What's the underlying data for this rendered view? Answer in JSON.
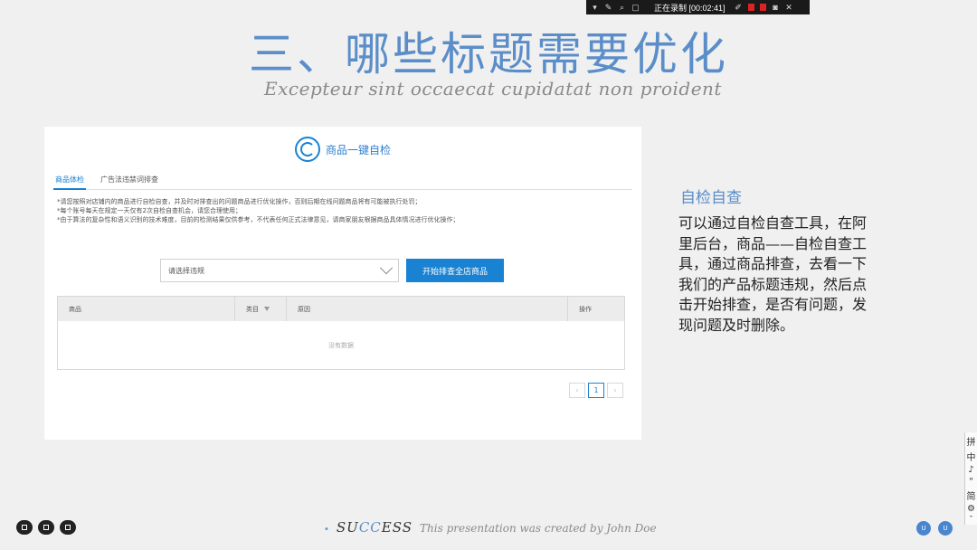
{
  "recorder": {
    "status": "正在录制 [00:02:41]"
  },
  "slide": {
    "title": "三、哪些标题需要优化",
    "subtitle": "Excepteur sint occaecat cupidatat non proident"
  },
  "panel": {
    "title": "商品一键自检",
    "tabs": [
      {
        "label": "商品体检",
        "active": true
      },
      {
        "label": "广告法违禁词排查",
        "active": false
      }
    ],
    "notice_lines": [
      "*请您按照对店铺内的商品进行自检自查，并及时对排查出的问题商品进行优化操作，否则后期在线问题商品将有可能被执行处罚；",
      "*每个账号每天在规定一天仅有2次自检自查机会，请您合理使用；",
      "*由于算法的复杂性和语义识别的技术难度，目前的检测结果仅供参考，不代表任何正式法律意见，请商家朋友根据商品具体情况进行优化操作；"
    ],
    "select_value": "请选择违规",
    "start_button": "开始排查全店商品",
    "table": {
      "columns": [
        "商品",
        "类目",
        "原因",
        "操作"
      ],
      "empty_text": "没有数据"
    },
    "pagination": {
      "prev": "‹",
      "current": "1",
      "next": "›"
    }
  },
  "side": {
    "heading": "自检自查",
    "body": "可以通过自检自查工具，在阿里后台，商品——自检自查工具，通过商品排查，去看一下我们的产品标题违规，然后点击开始排查，是否有问题，发现问题及时删除。"
  },
  "ime": [
    "拼",
    "中",
    "♪",
    "\"",
    "简",
    "⚙",
    "¯"
  ],
  "footer": {
    "brand_pre": "SU",
    "brand_hl": "CC",
    "brand_post": "ESS",
    "text": "This presentation was created by John Doe"
  }
}
